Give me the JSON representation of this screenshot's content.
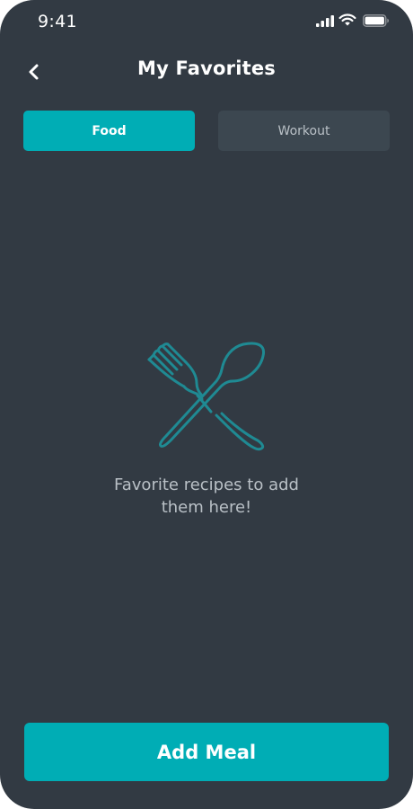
{
  "status_bar": {
    "time": "9:41",
    "icons": [
      "signal-icon",
      "wifi-icon",
      "battery-icon"
    ]
  },
  "header": {
    "title": "My Favorites",
    "back_icon": "chevron-left-icon"
  },
  "tabs": [
    {
      "label": "Food",
      "selected": true
    },
    {
      "label": "Workout",
      "selected": false
    }
  ],
  "empty_state": {
    "icon": "fork-spoon-icon",
    "message_line1": "Favorite recipes to add",
    "message_line2": "them here!"
  },
  "footer": {
    "button_label": "Add Meal"
  },
  "colors": {
    "background": "#323a43",
    "accent": "#00adb5",
    "tab_inactive": "#3c4750",
    "illustration": "#1f8a93",
    "muted_text": "#b9c0c6"
  }
}
